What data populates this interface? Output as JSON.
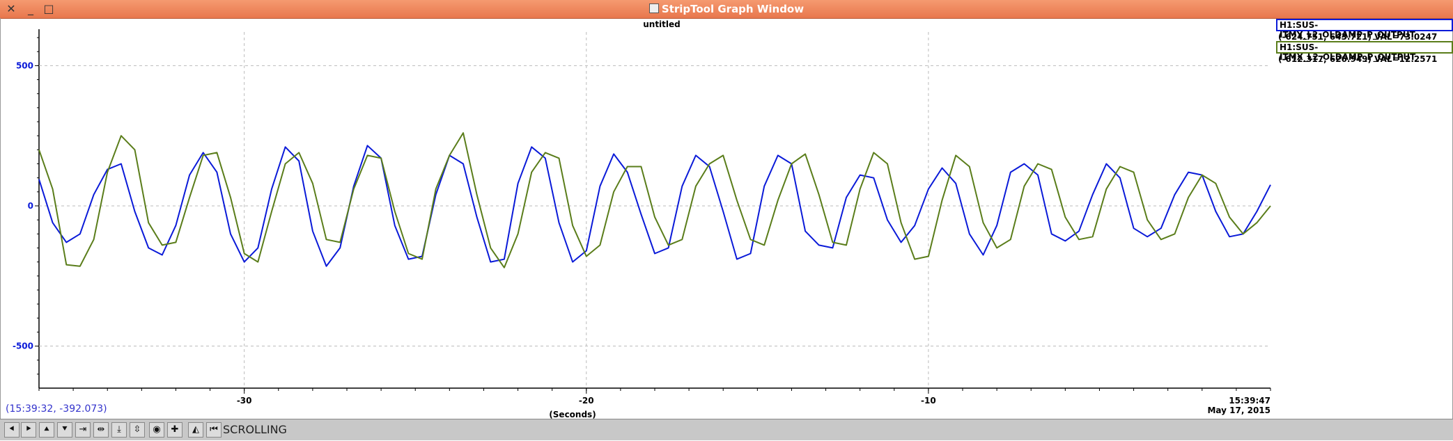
{
  "window": {
    "title": "StripTool Graph Window",
    "close_glyph": "✕",
    "minimize_glyph": "_",
    "maximize_glyph": "□"
  },
  "legend": [
    {
      "name": "H1:SUS-ITMY_L2_OLDAMP_P_OUTPUT",
      "range": "(-624.751, 643.721) VAL=73.0247",
      "color": "#0a1ad8"
    },
    {
      "name": "H1:SUS-ITMX_L2_OLDAMP_P_OUTPUT",
      "range": "(-612.317, 626.949) VAL=12.2571",
      "color": "#5a7d1a"
    }
  ],
  "cursor_readout": "(15:39:32, -392.073)",
  "timestamp": {
    "time": "15:39:47",
    "date": "May 17, 2015"
  },
  "toolbar": {
    "mode_label": "SCROLLING",
    "tools": [
      {
        "name": "scroll-left-button",
        "icon": "arrow-left-icon",
        "glyph": "⯇"
      },
      {
        "name": "scroll-right-button",
        "icon": "arrow-right-icon",
        "glyph": "⯈"
      },
      {
        "name": "scroll-up-button",
        "icon": "arrow-up-icon",
        "glyph": "⯅"
      },
      {
        "name": "scroll-down-button",
        "icon": "arrow-down-icon",
        "glyph": "⯆"
      },
      {
        "name": "zoom-in-x-button",
        "icon": "zoom-in-x-icon",
        "glyph": "⇥"
      },
      {
        "name": "zoom-out-x-button",
        "icon": "zoom-out-x-icon",
        "glyph": "⇹"
      },
      {
        "name": "zoom-in-y-button",
        "icon": "zoom-in-y-icon",
        "glyph": "⤓"
      },
      {
        "name": "zoom-out-y-button",
        "icon": "zoom-out-y-icon",
        "glyph": "⇳"
      },
      {
        "name": "pan-button",
        "icon": "pan-icon",
        "glyph": "◉"
      },
      {
        "name": "zoom-button",
        "icon": "zoom-icon",
        "glyph": "✚"
      },
      {
        "name": "auto-scale-button",
        "icon": "auto-scale-icon",
        "glyph": "◭"
      },
      {
        "name": "reset-button",
        "icon": "reset-icon",
        "glyph": "⏮"
      }
    ]
  },
  "chart_data": {
    "type": "line",
    "title": "untitled",
    "xlabel": "(Seconds)",
    "ylabel": "",
    "xlim": [
      -36,
      0
    ],
    "ylim": [
      -640,
      620
    ],
    "xticks": [
      -30,
      -20,
      -10
    ],
    "yticks": [
      500,
      0,
      -500
    ],
    "grid": true,
    "legend_position": "top-right",
    "series": [
      {
        "name": "H1:SUS-ITMY_L2_OLDAMP_P_OUTPUT",
        "color": "#0a1ad8",
        "x": [
          -36,
          -35.6,
          -35.2,
          -34.8,
          -34.4,
          -34,
          -33.6,
          -33.2,
          -32.8,
          -32.4,
          -32,
          -31.6,
          -31.2,
          -30.8,
          -30.4,
          -30,
          -29.6,
          -29.2,
          -28.8,
          -28.4,
          -28,
          -27.6,
          -27.2,
          -26.8,
          -26.4,
          -26,
          -25.6,
          -25.2,
          -24.8,
          -24.4,
          -24,
          -23.6,
          -23.2,
          -22.8,
          -22.4,
          -22,
          -21.6,
          -21.2,
          -20.8,
          -20.4,
          -20,
          -19.6,
          -19.2,
          -18.8,
          -18.4,
          -18,
          -17.6,
          -17.2,
          -16.8,
          -16.4,
          -16,
          -15.6,
          -15.2,
          -14.8,
          -14.4,
          -14,
          -13.6,
          -13.2,
          -12.8,
          -12.4,
          -12,
          -11.6,
          -11.2,
          -10.8,
          -10.4,
          -10,
          -9.6,
          -9.2,
          -8.8,
          -8.4,
          -8,
          -7.6,
          -7.2,
          -6.8,
          -6.4,
          -6,
          -5.6,
          -5.2,
          -4.8,
          -4.4,
          -4,
          -3.6,
          -3.2,
          -2.8,
          -2.4,
          -2,
          -1.6,
          -1.2,
          -0.8,
          -0.4,
          0
        ],
        "y": [
          95,
          -60,
          -130,
          -100,
          40,
          130,
          150,
          -20,
          -150,
          -175,
          -70,
          110,
          190,
          120,
          -100,
          -200,
          -150,
          60,
          210,
          160,
          -90,
          -215,
          -150,
          70,
          215,
          170,
          -70,
          -190,
          -180,
          40,
          180,
          150,
          -40,
          -200,
          -190,
          80,
          210,
          170,
          -60,
          -200,
          -160,
          70,
          185,
          120,
          -30,
          -170,
          -150,
          70,
          180,
          140,
          -20,
          -190,
          -170,
          70,
          180,
          150,
          -90,
          -140,
          -150,
          30,
          110,
          100,
          -50,
          -130,
          -70,
          60,
          135,
          80,
          -100,
          -175,
          -70,
          120,
          150,
          110,
          -100,
          -125,
          -90,
          40,
          150,
          100,
          -80,
          -110,
          -80,
          40,
          120,
          110,
          -20,
          -110,
          -100,
          -20,
          75
        ]
      },
      {
        "name": "H1:SUS-ITMX_L2_OLDAMP_P_OUTPUT",
        "color": "#5a7d1a",
        "x": [
          -36,
          -35.6,
          -35.2,
          -34.8,
          -34.4,
          -34,
          -33.6,
          -33.2,
          -32.8,
          -32.4,
          -32,
          -31.6,
          -31.2,
          -30.8,
          -30.4,
          -30,
          -29.6,
          -29.2,
          -28.8,
          -28.4,
          -28,
          -27.6,
          -27.2,
          -26.8,
          -26.4,
          -26,
          -25.6,
          -25.2,
          -24.8,
          -24.4,
          -24,
          -23.6,
          -23.2,
          -22.8,
          -22.4,
          -22,
          -21.6,
          -21.2,
          -20.8,
          -20.4,
          -20,
          -19.6,
          -19.2,
          -18.8,
          -18.4,
          -18,
          -17.6,
          -17.2,
          -16.8,
          -16.4,
          -16,
          -15.6,
          -15.2,
          -14.8,
          -14.4,
          -14,
          -13.6,
          -13.2,
          -12.8,
          -12.4,
          -12,
          -11.6,
          -11.2,
          -10.8,
          -10.4,
          -10,
          -9.6,
          -9.2,
          -8.8,
          -8.4,
          -8,
          -7.6,
          -7.2,
          -6.8,
          -6.4,
          -6,
          -5.6,
          -5.2,
          -4.8,
          -4.4,
          -4,
          -3.6,
          -3.2,
          -2.8,
          -2.4,
          -2,
          -1.6,
          -1.2,
          -0.8,
          -0.4,
          0
        ],
        "y": [
          200,
          60,
          -210,
          -215,
          -120,
          120,
          250,
          200,
          -60,
          -140,
          -130,
          30,
          180,
          190,
          30,
          -170,
          -200,
          -20,
          150,
          190,
          80,
          -120,
          -130,
          60,
          180,
          170,
          -20,
          -170,
          -190,
          60,
          180,
          260,
          40,
          -150,
          -220,
          -100,
          120,
          190,
          170,
          -70,
          -180,
          -140,
          50,
          140,
          140,
          -40,
          -140,
          -120,
          70,
          150,
          180,
          20,
          -120,
          -140,
          20,
          150,
          185,
          40,
          -130,
          -140,
          60,
          190,
          150,
          -60,
          -190,
          -180,
          20,
          180,
          140,
          -60,
          -150,
          -120,
          70,
          150,
          130,
          -40,
          -120,
          -110,
          60,
          140,
          120,
          -50,
          -120,
          -100,
          30,
          110,
          80,
          -40,
          -100,
          -60,
          0
        ]
      }
    ]
  }
}
